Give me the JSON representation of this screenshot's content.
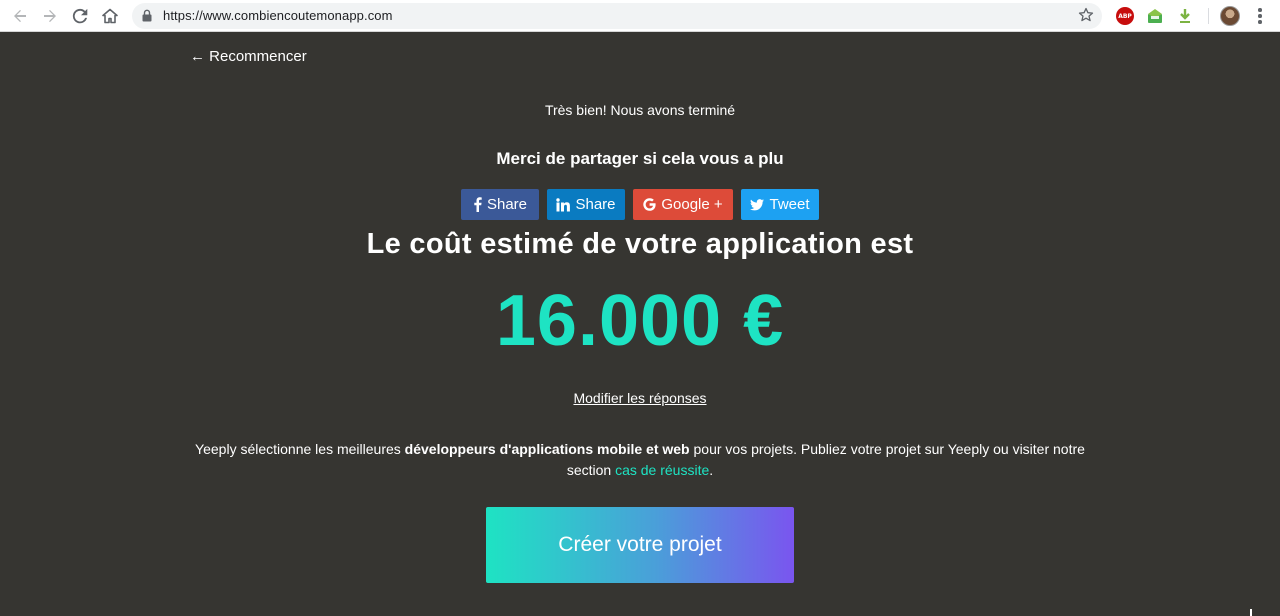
{
  "browser": {
    "url": "https://www.combiencoutemonapp.com",
    "icons": [
      "back-icon",
      "forward-icon",
      "reload-icon",
      "home-icon",
      "lock-icon",
      "star-icon",
      "adblock-icon",
      "inbox-extension-icon",
      "download-extension-icon",
      "profile-avatar",
      "chrome-menu-icon"
    ],
    "abp_label": "ABP"
  },
  "page": {
    "back_link": "← Recommencer",
    "subtitle": "Très bien! Nous avons terminé",
    "share_prompt": "Merci de partager si cela vous a plu",
    "share_buttons": [
      {
        "label": "Share",
        "icon": "facebook-icon",
        "color": "#3b5998"
      },
      {
        "label": "Share",
        "icon": "linkedin-icon",
        "color": "#0a7bc1"
      },
      {
        "label": "Google +",
        "icon": "google-icon",
        "color": "#dd4b39"
      },
      {
        "label": "Tweet",
        "icon": "twitter-icon",
        "color": "#1da1f2"
      }
    ],
    "cost_label": "Le coût estimé de votre application est",
    "cost_value": "16.000 €",
    "modify_link": "Modifier les réponses",
    "description": {
      "part1": "Yeeply sélectionne les meilleures ",
      "bold": "développeurs d'applications mobile et web",
      "part2": " pour vos projets. Publiez votre projet sur Yeeply ou visiter notre section ",
      "link": "cas de réussite",
      "part3": "."
    },
    "cta_button": "Créer votre projet"
  },
  "colors": {
    "background": "#363531",
    "accent": "#1ee3c3",
    "cta_gradient": [
      "#1ee3c3",
      "#7a55ef"
    ]
  }
}
